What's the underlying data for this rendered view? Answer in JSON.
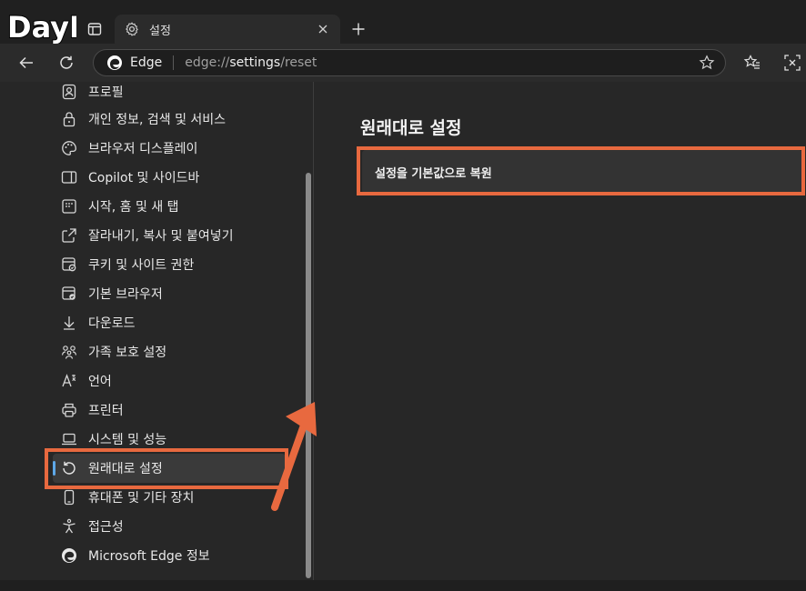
{
  "watermark": {
    "text": "DayB"
  },
  "tab": {
    "title": "설정",
    "icon": "gear-icon"
  },
  "address": {
    "site_name": "Edge",
    "url_prefix": "edge://",
    "url_highlight": "settings",
    "url_suffix": "/reset"
  },
  "sidebar": {
    "items": [
      {
        "label": "프로필",
        "icon": "profile-icon"
      },
      {
        "label": "개인 정보, 검색 및 서비스",
        "icon": "lock-icon"
      },
      {
        "label": "브라우저 디스플레이",
        "icon": "palette-icon"
      },
      {
        "label": "Copilot 및 사이드바",
        "icon": "sidebar-icon"
      },
      {
        "label": "시작, 홈 및 새 탭",
        "icon": "home-grid-icon"
      },
      {
        "label": "잘라내기, 복사 및 붙여넣기",
        "icon": "share-icon"
      },
      {
        "label": "쿠키 및 사이트 권한",
        "icon": "cookie-icon"
      },
      {
        "label": "기본 브라우저",
        "icon": "default-browser-icon"
      },
      {
        "label": "다운로드",
        "icon": "download-icon"
      },
      {
        "label": "가족 보호 설정",
        "icon": "family-icon"
      },
      {
        "label": "언어",
        "icon": "language-icon"
      },
      {
        "label": "프린터",
        "icon": "printer-icon"
      },
      {
        "label": "시스템 및 성능",
        "icon": "laptop-icon"
      },
      {
        "label": "원래대로 설정",
        "icon": "reset-icon",
        "active": true
      },
      {
        "label": "휴대폰 및 기타 장치",
        "icon": "phone-icon"
      },
      {
        "label": "접근성",
        "icon": "accessibility-icon"
      },
      {
        "label": "Microsoft Edge 정보",
        "icon": "edge-icon"
      }
    ]
  },
  "main": {
    "title": "원래대로 설정",
    "reset_option": "설정을 기본값으로 복원"
  },
  "colors": {
    "accent": "#5ea8e8",
    "highlight": "#e8693f",
    "background": "#272727"
  }
}
